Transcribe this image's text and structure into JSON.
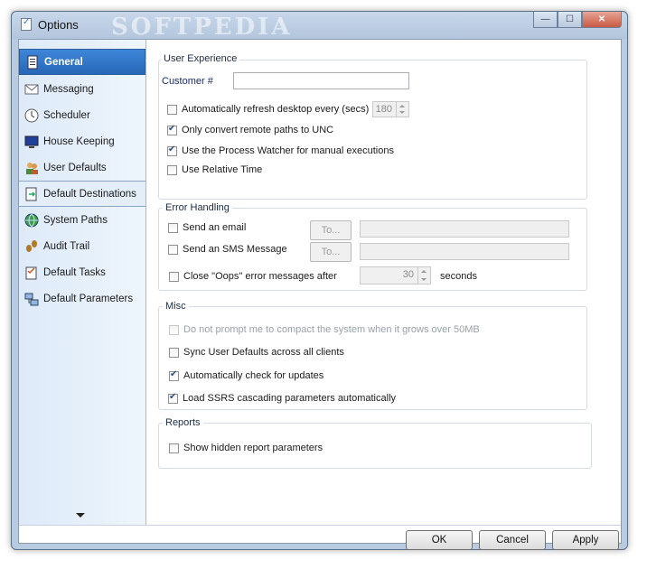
{
  "window": {
    "title": "Options",
    "watermark": "SOFTPEDIA",
    "controls": {
      "minimize": "—",
      "maximize": "☐",
      "close": "✕"
    }
  },
  "sidebar": {
    "items": [
      {
        "label": "General",
        "icon": "general-icon",
        "active": true
      },
      {
        "label": "Messaging",
        "icon": "messaging-icon"
      },
      {
        "label": "Scheduler",
        "icon": "clock-icon"
      },
      {
        "label": "House Keeping",
        "icon": "monitor-icon"
      },
      {
        "label": "User Defaults",
        "icon": "users-icon"
      },
      {
        "label": "Default Destinations",
        "icon": "destination-icon",
        "outlined": true
      },
      {
        "label": "System Paths",
        "icon": "globe-icon"
      },
      {
        "label": "Audit Trail",
        "icon": "footprint-icon"
      },
      {
        "label": "Default Tasks",
        "icon": "tasks-icon"
      },
      {
        "label": "Default Parameters",
        "icon": "parameters-icon"
      }
    ],
    "scroll_down": "scroll-down-icon"
  },
  "user_experience": {
    "title": "User Experience",
    "customer_label": "Customer #",
    "customer_value": "",
    "auto_refresh_label": "Automatically refresh desktop every (secs)",
    "auto_refresh_checked": false,
    "auto_refresh_value": "180",
    "unc_label": "Only convert remote paths to UNC",
    "unc_checked": true,
    "watcher_label": "Use the Process Watcher for manual executions",
    "watcher_checked": true,
    "relative_time_label": "Use Relative Time",
    "relative_time_checked": false
  },
  "error_handling": {
    "title": "Error Handling",
    "email_label": "Send an email",
    "email_button": "To...",
    "sms_label": "Send an SMS Message",
    "sms_button": "To...",
    "oops_label": "Close \"Oops\" error messages after",
    "oops_value": "30",
    "oops_unit": "seconds"
  },
  "misc": {
    "title": "Misc",
    "compact_label": "Do not prompt me to compact the system when it grows over 50MB",
    "sync_label": "Sync User Defaults across all clients",
    "updates_label": "Automatically check for updates",
    "ssrs_label": "Load SSRS cascading parameters automatically"
  },
  "reports": {
    "title": "Reports",
    "hidden_params_label": "Show hidden report parameters"
  },
  "footer": {
    "ok": "OK",
    "cancel": "Cancel",
    "apply": "Apply"
  },
  "colors": {
    "active_nav": "#2f72c6",
    "window_frame": "#b9cbe0"
  }
}
